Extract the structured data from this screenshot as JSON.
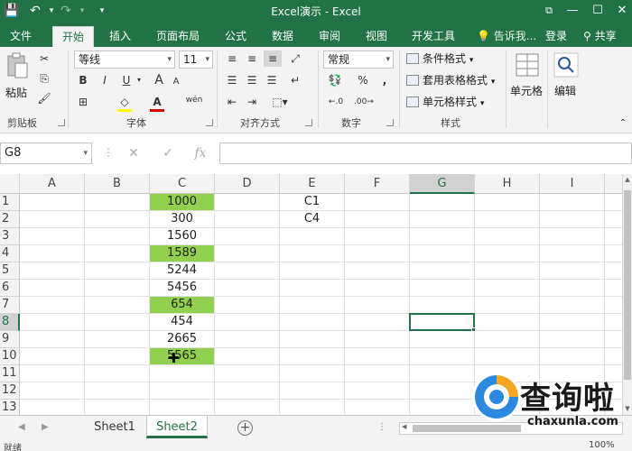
{
  "app": {
    "title": "Excel演示 - Excel",
    "qa_save": "💾",
    "qa_undo": "↶",
    "qa_redo": "↷",
    "qa_more": "▾",
    "wc_restore": "⧉",
    "wc_min": "—",
    "wc_max": "☐",
    "wc_close": "✕"
  },
  "ribbon_tabs": [
    "文件",
    "开始",
    "插入",
    "页面布局",
    "公式",
    "数据",
    "审阅",
    "视图",
    "开发工具"
  ],
  "tell_me": "💡 告诉我...",
  "login": "登录",
  "share": "共享",
  "ribbon": {
    "clipboard": {
      "paste_label": "粘贴",
      "group_label": "剪贴板"
    },
    "font": {
      "name": "等线",
      "size": "11",
      "bold": "B",
      "italic": "I",
      "underline": "U",
      "grow": "A",
      "shrink": "A",
      "font_color": "A",
      "phonetic": "wén",
      "group_label": "字体"
    },
    "alignment": {
      "group_label": "对齐方式"
    },
    "number": {
      "format": "常规",
      "percent": "%",
      "comma": ",",
      "group_label": "数字"
    },
    "styles": {
      "conditional": "条件格式",
      "as_table": "套用表格格式",
      "cell_styles": "单元格样式",
      "group_label": "样式"
    },
    "cells": {
      "label": "单元格"
    },
    "editing": {
      "label": "编辑"
    }
  },
  "formula_bar": {
    "name_box": "G8",
    "cancel": "✕",
    "enter": "✓",
    "fx": "fx"
  },
  "columns": [
    "A",
    "B",
    "C",
    "D",
    "E",
    "F",
    "G",
    "H",
    "I"
  ],
  "rows": [
    "1",
    "2",
    "3",
    "4",
    "5",
    "6",
    "7",
    "8",
    "9",
    "10",
    "11",
    "12",
    "13"
  ],
  "selected_cell": "G8",
  "cells": {
    "C": [
      "1000",
      "300",
      "1560",
      "1589",
      "5244",
      "5456",
      "654",
      "454",
      "2665",
      "5565",
      "",
      "",
      ""
    ],
    "E": [
      "C1",
      "C4",
      "",
      "",
      "",
      "",
      "",
      "",
      "",
      "",
      "",
      "",
      ""
    ]
  },
  "highlighted_rows_in_C": [
    1,
    4,
    7,
    10
  ],
  "highlight_color": "#92d050",
  "accent_color": "#217346",
  "sheets": [
    "Sheet1",
    "Sheet2"
  ],
  "active_sheet": "Sheet2",
  "status": {
    "ready": "就绪",
    "zoom": "100%"
  },
  "watermark": {
    "chinese": "查询啦",
    "domain": "chaxunla.com"
  }
}
